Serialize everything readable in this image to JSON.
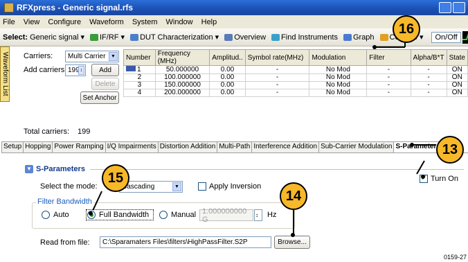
{
  "window": {
    "title": "RFXpress - Generic signal.rfs"
  },
  "menu": [
    "File",
    "View",
    "Configure",
    "Waveform",
    "System",
    "Window",
    "Help"
  ],
  "toolbar": {
    "select_label": "Select:",
    "generic_signal": "Generic signal",
    "if_rf": "IF/RF",
    "dut": "DUT Characterization",
    "overview": "Overview",
    "find_instruments": "Find Instruments",
    "graph": "Graph",
    "compile": "Compile",
    "onoff": "On/Off"
  },
  "side_tab": "Waveform List",
  "carriers": {
    "carriers_label": "Carriers:",
    "carriers_value": "Multi Carrier",
    "add_carriers_label": "Add carriers:",
    "add_count": "199",
    "add_button": "Add",
    "delete_button": "Delete",
    "set_anchor_button": "Set Anchor",
    "total_label": "Total carriers:",
    "total_value": "199"
  },
  "carrier_table": {
    "headers": [
      "Number",
      "Frequency (MHz)",
      "Amplitud..",
      "Symbol rate(MHz)",
      "Modulation",
      "Filter",
      "Alpha/B*T",
      "State"
    ],
    "rows": [
      [
        "1",
        "50.000000",
        "0.00",
        "-",
        "No Mod",
        "-",
        "-",
        "ON"
      ],
      [
        "2",
        "100.000000",
        "0.00",
        "-",
        "No Mod",
        "-",
        "-",
        "ON"
      ],
      [
        "3",
        "150.000000",
        "0.00",
        "-",
        "No Mod",
        "-",
        "-",
        "ON"
      ],
      [
        "4",
        "200.000000",
        "0.00",
        "-",
        "No Mod",
        "-",
        "-",
        "ON"
      ]
    ]
  },
  "tabs": [
    "Setup",
    "Hopping",
    "Power Ramping",
    "I/Q Impairments",
    "Distortion Addition",
    "Multi-Path",
    "Interference Addition",
    "Sub-Carrier Modulation",
    "S-Parameters"
  ],
  "sparams": {
    "section_title": "S-Parameters",
    "turn_on": "Turn On",
    "select_mode_label": "Select the mode:",
    "mode_value": "Cascading",
    "apply_inversion": "Apply Inversion",
    "filter_bandwidth": "Filter Bandwidth",
    "auto": "Auto",
    "full_bandwidth": "Full Bandwidth",
    "manual": "Manual",
    "manual_value": "1.000000000 G",
    "hz": "Hz",
    "read_from_file_label": "Read from file:",
    "file_path": "C:\\Sparamaters Files\\filters\\HighPassFilter.S2P",
    "browse": "Browse..."
  },
  "callouts": {
    "c13": "13",
    "c14": "14",
    "c15": "15",
    "c16": "16"
  },
  "figure_id": "0159-27"
}
